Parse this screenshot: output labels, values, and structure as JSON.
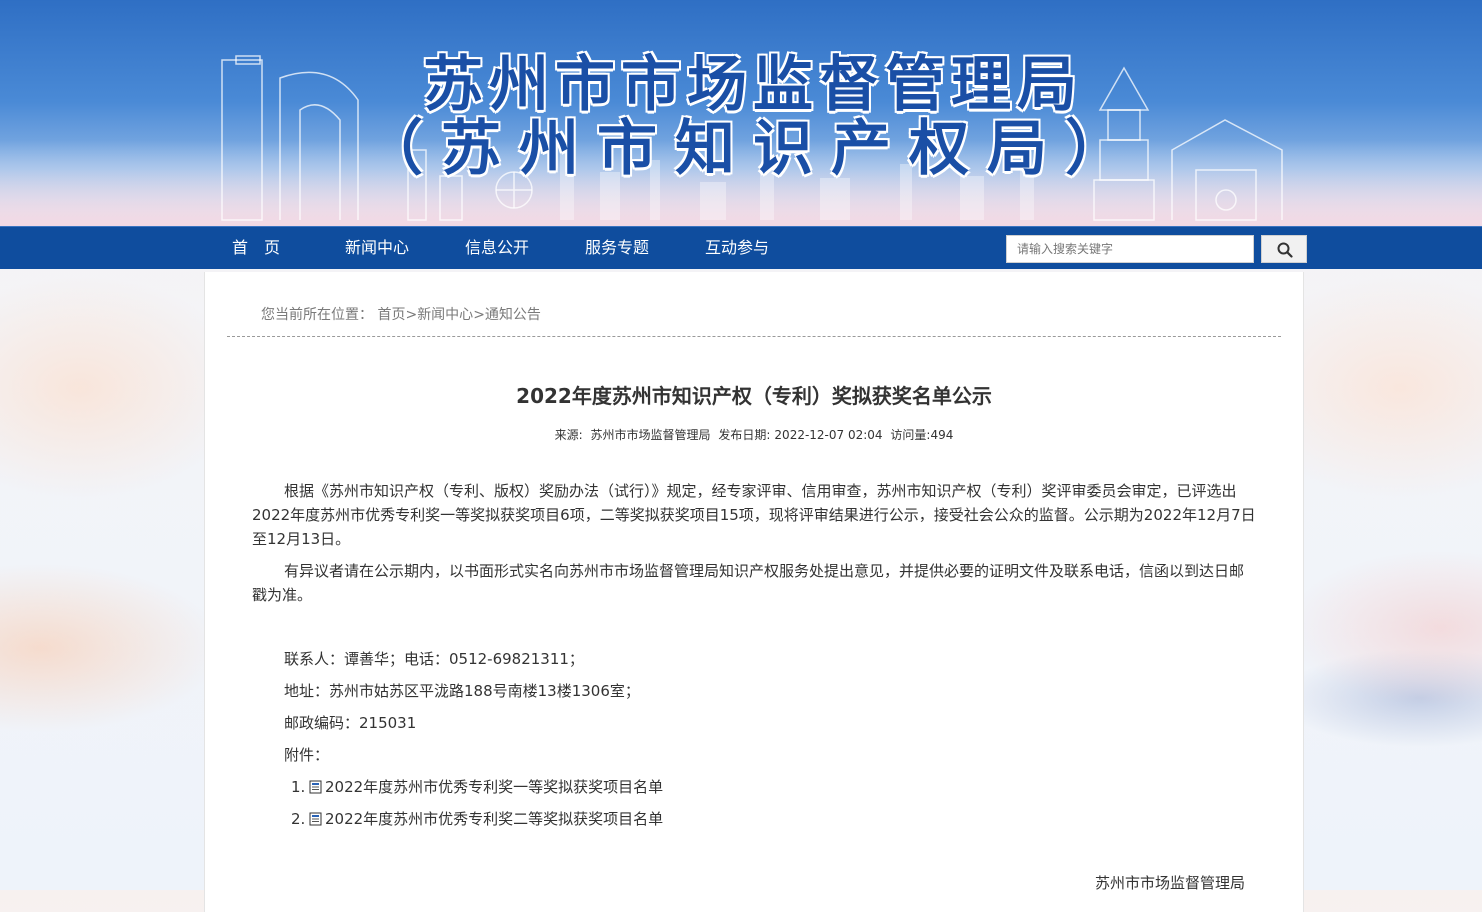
{
  "banner": {
    "title_line1": "苏州市市场监督管理局",
    "title_line2": "（苏州市知识产权局）"
  },
  "nav": {
    "items": [
      {
        "label": "首　页"
      },
      {
        "label": "新闻中心"
      },
      {
        "label": "信息公开"
      },
      {
        "label": "服务专题"
      },
      {
        "label": "互动参与"
      }
    ],
    "search_placeholder": "请输入搜索关键字",
    "search_icon": "search-icon"
  },
  "breadcrumb": {
    "prefix": "您当前所在位置：",
    "items": [
      "首页",
      "新闻中心",
      "通知公告"
    ],
    "sep": ">"
  },
  "article": {
    "title": "2022年度苏州市知识产权（专利）奖拟获奖名单公示",
    "source_label": "来源:",
    "source": "苏州市市场监督管理局",
    "date_label": "发布日期:",
    "date": "2022-12-07 02:04",
    "views_label": "访问量:",
    "views": "494",
    "para1": "根据《苏州市知识产权（专利、版权）奖励办法（试行）》规定，经专家评审、信用审查，苏州市知识产权（专利）奖评审委员会审定，已评选出2022年度苏州市优秀专利奖一等奖拟获奖项目6项，二等奖拟获奖项目15项，现将评审结果进行公示，接受社会公众的监督。公示期为2022年12月7日至12月13日。",
    "para2": "有异议者请在公示期内，以书面形式实名向苏州市市场监督管理局知识产权服务处提出意见，并提供必要的证明文件及联系电话，信函以到达日邮戳为准。",
    "contact": "联系人：谭善华；电话：0512-69821311；",
    "address": "地址：苏州市姑苏区平泷路188号南楼13楼1306室；",
    "postcode": "邮政编码：215031",
    "attachments_label": "附件：",
    "attachments": [
      {
        "num": "1.",
        "name": "2022年度苏州市优秀专利奖一等奖拟获奖项目名单"
      },
      {
        "num": "2.",
        "name": "2022年度苏州市优秀专利奖二等奖拟获奖项目名单"
      }
    ],
    "signoff": "苏州市市场监督管理局"
  }
}
